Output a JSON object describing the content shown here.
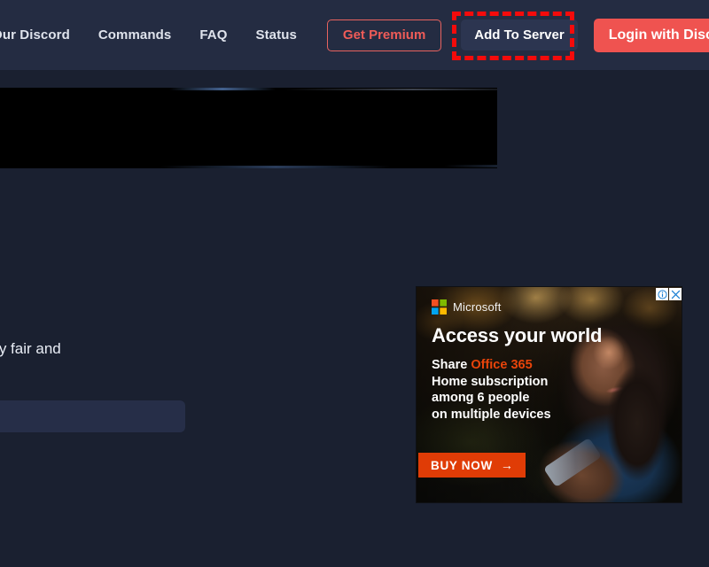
{
  "navbar": {
    "links": [
      {
        "label": "oin Our Discord",
        "name": "join-our-discord"
      },
      {
        "label": "Commands",
        "name": "commands"
      },
      {
        "label": "FAQ",
        "name": "faq"
      },
      {
        "label": "Status",
        "name": "status"
      }
    ],
    "premium_button": "Get Premium",
    "add_to_server_button": "Add To Server",
    "login_button": "Login with Discord",
    "colors": {
      "background": "#242c42",
      "accent_red": "#ef5350",
      "premium_outline": "#e8635f",
      "add_to_server_bg": "#2c3550",
      "highlight_outline": "#f50b0b"
    }
  },
  "page": {
    "background": "#1a2030",
    "body_text": "rs a completely fair and"
  },
  "ad": {
    "brand": "Microsoft",
    "headline": "Access your world",
    "line1_prefix": "Share ",
    "line1_brand": "Office 365",
    "line2": "Home subscription",
    "line3": "among 6 people",
    "line4": "on multiple devices",
    "cta_label": "BUY NOW",
    "cta_arrow": "→",
    "cta_color": "#e03c06",
    "office_color": "#e8440a",
    "info_badge": "adchoices-info",
    "close_badge": "close"
  }
}
